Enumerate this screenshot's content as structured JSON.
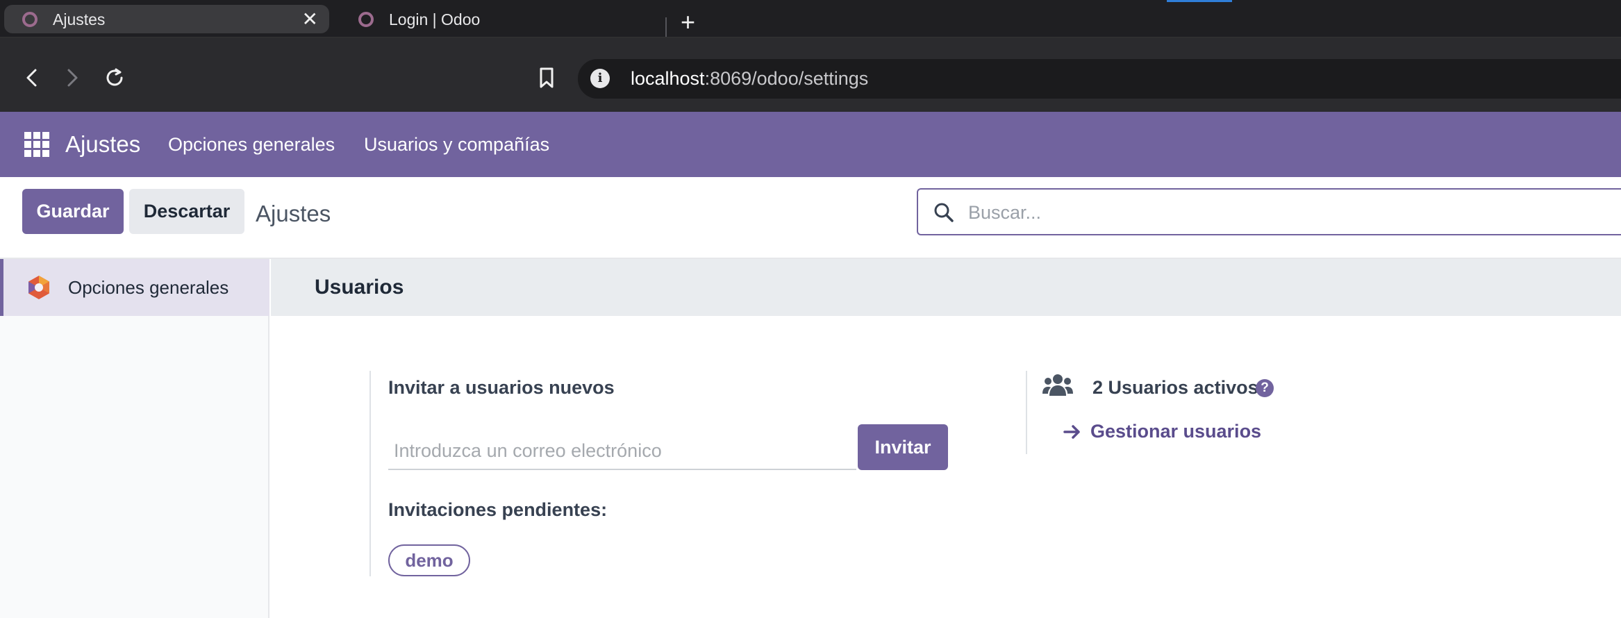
{
  "browser": {
    "tabs": [
      {
        "title": "Ajustes",
        "active": true,
        "close": "✕"
      },
      {
        "title": "Login | Odoo",
        "active": false
      }
    ],
    "new_tab": "+",
    "url_host": "localhost",
    "url_rest": ":8069/odoo/settings"
  },
  "navbar": {
    "app_name": "Ajustes",
    "menu": [
      "Opciones generales",
      "Usuarios y compañías"
    ],
    "color": "#71639e"
  },
  "control_panel": {
    "save_label": "Guardar",
    "discard_label": "Descartar",
    "title": "Ajustes",
    "search_placeholder": "Buscar..."
  },
  "sidebar": {
    "items": [
      {
        "label": "Opciones generales",
        "icon": "odoo-settings-logo-icon",
        "active": true
      }
    ]
  },
  "main": {
    "section_title": "Usuarios",
    "invite": {
      "label": "Invitar a usuarios nuevos",
      "email_placeholder": "Introduzca un correo electrónico",
      "button": "Invitar",
      "pending_label": "Invitaciones pendientes:",
      "pending": [
        "demo"
      ]
    },
    "users": {
      "active_label": "2 Usuarios activos",
      "help": "?",
      "manage_label": "Gestionar usuarios"
    }
  }
}
